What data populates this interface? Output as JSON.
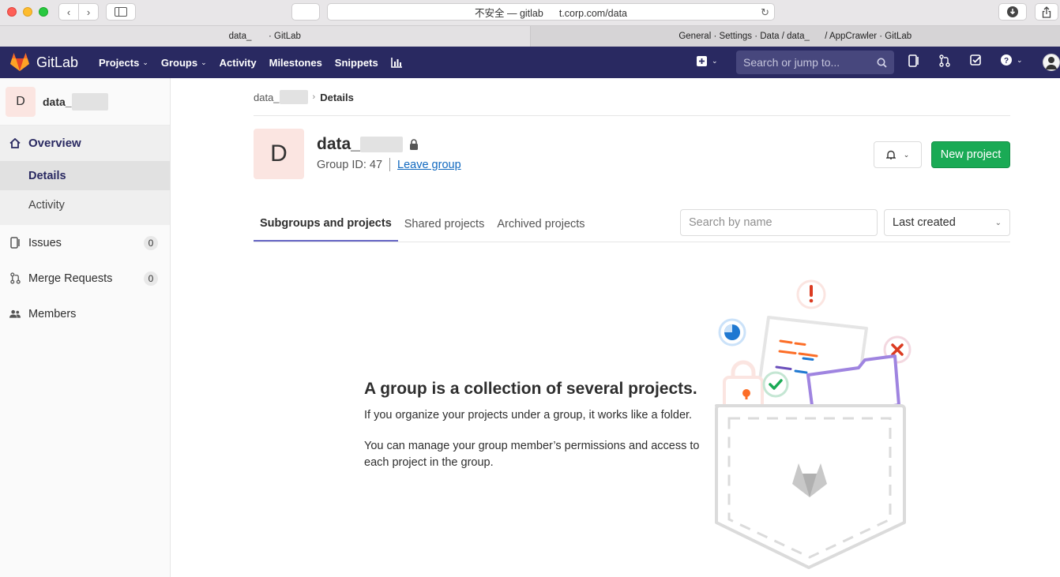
{
  "browser": {
    "address": "不安全 — gitlab        t.corp.com/data",
    "tabs": [
      {
        "label": "data_         · GitLab"
      },
      {
        "label": "General · Settings · Data / data_        / AppCrawler · GitLab"
      }
    ]
  },
  "topnav": {
    "brand": "GitLab",
    "items": [
      {
        "label": "Projects",
        "dropdown": true
      },
      {
        "label": "Groups",
        "dropdown": true
      },
      {
        "label": "Activity"
      },
      {
        "label": "Milestones"
      },
      {
        "label": "Snippets"
      }
    ],
    "search_placeholder": "Search or jump to...",
    "color": "#292961"
  },
  "sidebar": {
    "group_initial": "D",
    "group_name": "data_",
    "overview": "Overview",
    "sub_items": [
      {
        "label": "Details",
        "active": true
      },
      {
        "label": "Activity",
        "active": false
      }
    ],
    "items": [
      {
        "label": "Issues",
        "count": "0"
      },
      {
        "label": "Merge Requests",
        "count": "0"
      },
      {
        "label": "Members"
      }
    ]
  },
  "main": {
    "breadcrumb": {
      "parent": "data_",
      "current": "Details"
    },
    "group": {
      "initial": "D",
      "title": "data_",
      "group_id": "Group ID: 47",
      "leave": "Leave group"
    },
    "new_project": "New project",
    "tabs": [
      {
        "label": "Subgroups and projects",
        "active": true
      },
      {
        "label": "Shared projects"
      },
      {
        "label": "Archived projects"
      }
    ],
    "search_placeholder": "Search by name",
    "sort": "Last created",
    "empty": {
      "title": "A group is a collection of several projects.",
      "p1": "If you organize your projects under a group, it works like a folder.",
      "p2": "You can manage your group member’s permissions and access to each project in the group."
    },
    "accent": "#1aaa55"
  }
}
